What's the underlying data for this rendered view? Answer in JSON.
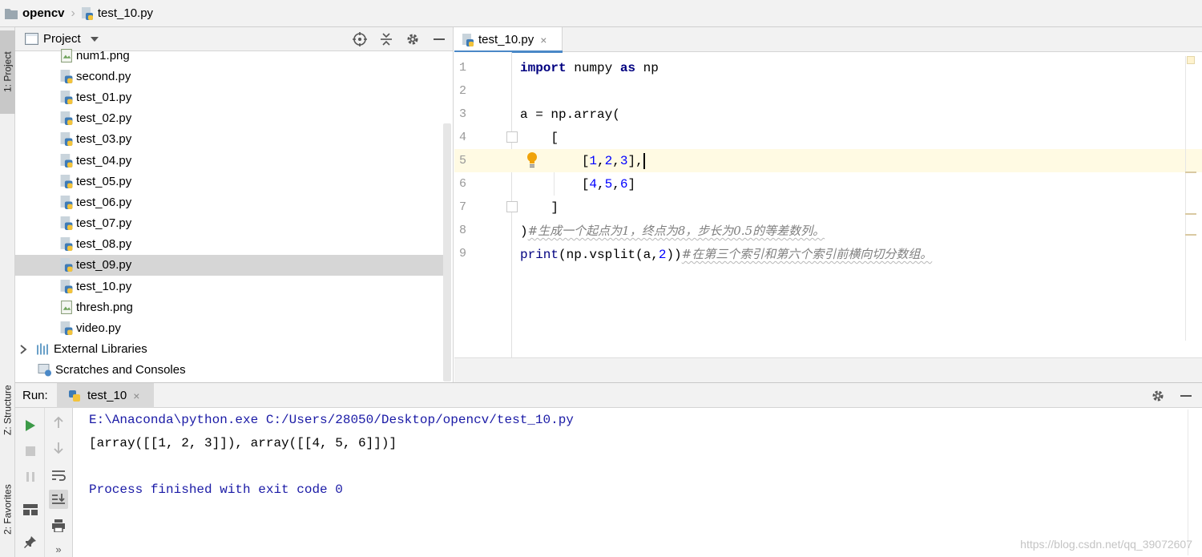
{
  "breadcrumb": {
    "project": "opencv",
    "file": "test_10.py"
  },
  "left_strip": {
    "project_tab": "1: Project",
    "structure_tab": "Z: Structure",
    "favorites_tab": "2: Favorites"
  },
  "project_panel": {
    "title": "Project",
    "files": [
      {
        "name": "num1.png",
        "type": "image"
      },
      {
        "name": "second.py",
        "type": "python"
      },
      {
        "name": "test_01.py",
        "type": "python"
      },
      {
        "name": "test_02.py",
        "type": "python"
      },
      {
        "name": "test_03.py",
        "type": "python"
      },
      {
        "name": "test_04.py",
        "type": "python"
      },
      {
        "name": "test_05.py",
        "type": "python"
      },
      {
        "name": "test_06.py",
        "type": "python"
      },
      {
        "name": "test_07.py",
        "type": "python"
      },
      {
        "name": "test_08.py",
        "type": "python"
      },
      {
        "name": "test_09.py",
        "type": "python",
        "selected": true
      },
      {
        "name": "test_10.py",
        "type": "python"
      },
      {
        "name": "thresh.png",
        "type": "image"
      },
      {
        "name": "video.py",
        "type": "python"
      }
    ],
    "external_libraries": "External Libraries",
    "scratches": "Scratches and Consoles"
  },
  "editor": {
    "tab_label": "test_10.py",
    "tab_close": "×",
    "line_numbers": [
      "1",
      "2",
      "3",
      "4",
      "5",
      "6",
      "7",
      "8",
      "9"
    ],
    "current_line": 5,
    "code": {
      "l1_kw1": "import",
      "l1_mod": " numpy ",
      "l1_kw2": "as",
      "l1_alias": " np",
      "l3": "a = np.array(",
      "l4": "    [",
      "l5_open": "        [",
      "l5_n1": "1",
      "l5_c1": ",",
      "l5_n2": "2",
      "l5_c2": ",",
      "l5_n3": "3",
      "l5_close": "],",
      "l6_open": "        [",
      "l6_n1": "4",
      "l6_c1": ",",
      "l6_n2": "5",
      "l6_c2": ",",
      "l6_n3": "6",
      "l6_close": "]",
      "l7": "    ]",
      "l8_code": ")",
      "l8_comment": "#生成一个起点为1，终点为8，步长为0.5的等差数列。",
      "l9_print": "print",
      "l9_mid": "(np.vsplit(a,",
      "l9_num": "2",
      "l9_end": "))",
      "l9_comment": "#在第三个索引和第六个索引前横向切分数组。"
    }
  },
  "run_panel": {
    "label": "Run:",
    "tab_label": "test_10",
    "tab_close": "×",
    "output": {
      "command": "E:\\Anaconda\\python.exe C:/Users/28050/Desktop/opencv/test_10.py",
      "result": "[array([[1, 2, 3]]), array([[4, 5, 6]])]",
      "finished": "Process finished with exit code 0"
    }
  },
  "watermark": "https://blog.csdn.net/qq_39072607",
  "colors": {
    "keyword": "#000080",
    "number": "#0000ff",
    "comment": "#808080",
    "console_info": "#1a1aa6",
    "current_line": "#fffae3",
    "selection": "#d6d6d6",
    "run_green": "#3c9a48"
  }
}
